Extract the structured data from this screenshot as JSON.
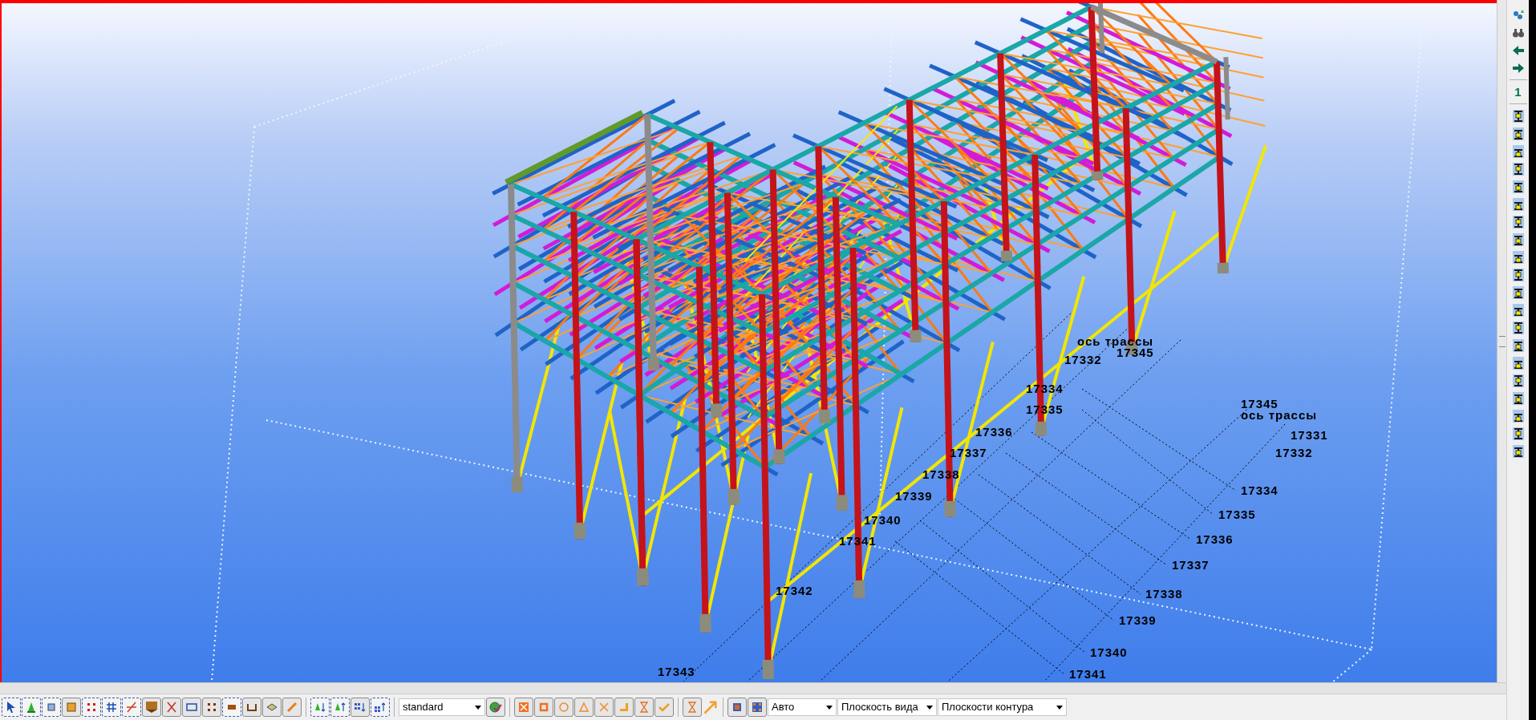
{
  "model_view": {
    "grid_labels": [
      {
        "text": "ось трассы"
      },
      {
        "text": "17345"
      },
      {
        "text": "17332"
      },
      {
        "text": "17334"
      },
      {
        "text": "17335"
      },
      {
        "text": "17336"
      },
      {
        "text": "17337"
      },
      {
        "text": "17338"
      },
      {
        "text": "17339"
      },
      {
        "text": "17340"
      },
      {
        "text": "17341"
      },
      {
        "text": "17342"
      },
      {
        "text": "17343"
      },
      {
        "text": "17345"
      },
      {
        "text": "ось трассы"
      },
      {
        "text": "17331"
      },
      {
        "text": "17332"
      },
      {
        "text": "17334"
      },
      {
        "text": "17335"
      },
      {
        "text": "17336"
      },
      {
        "text": "17337"
      },
      {
        "text": "17338"
      },
      {
        "text": "17339"
      },
      {
        "text": "17340"
      },
      {
        "text": "17341"
      }
    ]
  },
  "bottom_toolbar": {
    "filter": {
      "value": "standard"
    },
    "dropdowns": [
      {
        "value": "Авто"
      },
      {
        "value": "Плоскость вида"
      },
      {
        "value": "Плоскости контура"
      }
    ]
  },
  "right_toolbar": {
    "step_label": "1"
  }
}
